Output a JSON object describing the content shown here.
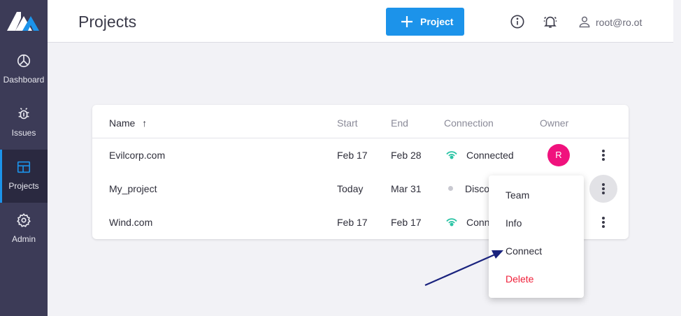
{
  "sidebar": {
    "items": [
      {
        "label": "Dashboard",
        "icon": "dashboard-icon"
      },
      {
        "label": "Issues",
        "icon": "bug-icon"
      },
      {
        "label": "Projects",
        "icon": "projects-icon",
        "active": true
      },
      {
        "label": "Admin",
        "icon": "gear-icon"
      }
    ]
  },
  "header": {
    "title": "Projects",
    "add_button_label": "Project",
    "user": "root@ro.ot"
  },
  "table": {
    "columns": [
      "Name",
      "Start",
      "End",
      "Connection",
      "Owner"
    ],
    "sort_indicator": "↑",
    "rows": [
      {
        "name": "Evilcorp.com",
        "start": "Feb 17",
        "end": "Feb 28",
        "connection": "Connected",
        "owner": "R"
      },
      {
        "name": "My_project",
        "start": "Today",
        "end": "Mar 31",
        "connection": "Disco"
      },
      {
        "name": "Wind.com",
        "start": "Feb 17",
        "end": "Feb 17",
        "connection": "Conn"
      }
    ]
  },
  "menu": {
    "items": [
      "Team",
      "Info",
      "Connect",
      "Delete"
    ]
  },
  "colors": {
    "sidebar": "#3c3b57",
    "accent": "#1c93ea",
    "connected": "#2bc4a5",
    "avatar": "#f0127d",
    "danger": "#f0203a"
  }
}
